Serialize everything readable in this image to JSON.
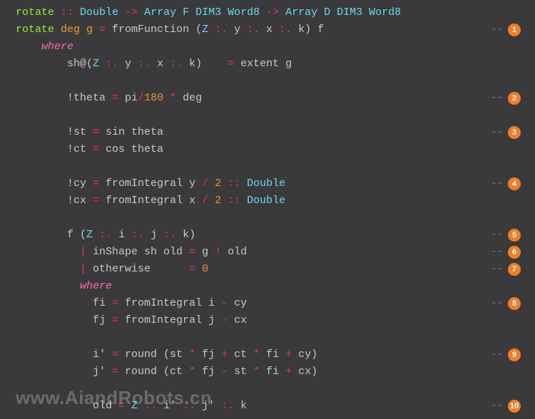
{
  "lines": [
    {
      "tokens": [
        {
          "t": "rotate ",
          "c": "fn"
        },
        {
          "t": ":: ",
          "c": "op"
        },
        {
          "t": "Double ",
          "c": "ty"
        },
        {
          "t": "-> ",
          "c": "op"
        },
        {
          "t": "Array F DIM3 Word8 ",
          "c": "ty"
        },
        {
          "t": "-> ",
          "c": "op"
        },
        {
          "t": "Array D DIM3 Word8",
          "c": "ty"
        }
      ]
    },
    {
      "tokens": [
        {
          "t": "rotate ",
          "c": "fn"
        },
        {
          "t": "deg g ",
          "c": "arg"
        },
        {
          "t": "= ",
          "c": "op"
        },
        {
          "t": "fromFunction (",
          "c": "pun"
        },
        {
          "t": "Z ",
          "c": "ty"
        },
        {
          "t": ":. ",
          "c": "op"
        },
        {
          "t": "y ",
          "c": "pun"
        },
        {
          "t": ":. ",
          "c": "op"
        },
        {
          "t": "x ",
          "c": "pun"
        },
        {
          "t": ":. ",
          "c": "op"
        },
        {
          "t": "k) f",
          "c": "pun"
        }
      ],
      "badge": "1"
    },
    {
      "tokens": [
        {
          "t": "    ",
          "c": "pun"
        },
        {
          "t": "where",
          "c": "kw"
        }
      ]
    },
    {
      "tokens": [
        {
          "t": "        sh@(",
          "c": "pun"
        },
        {
          "t": "Z ",
          "c": "ty"
        },
        {
          "t": ":. ",
          "c": "op"
        },
        {
          "t": "y ",
          "c": "pun"
        },
        {
          "t": ":. ",
          "c": "op"
        },
        {
          "t": "x ",
          "c": "pun"
        },
        {
          "t": ":. ",
          "c": "op"
        },
        {
          "t": "k)    ",
          "c": "pun"
        },
        {
          "t": "= ",
          "c": "op"
        },
        {
          "t": "extent g",
          "c": "pun"
        }
      ]
    },
    {
      "tokens": [
        {
          "t": " ",
          "c": "pun"
        }
      ]
    },
    {
      "tokens": [
        {
          "t": "        !theta ",
          "c": "pun"
        },
        {
          "t": "= ",
          "c": "op"
        },
        {
          "t": "pi",
          "c": "pun"
        },
        {
          "t": "/",
          "c": "op"
        },
        {
          "t": "180 ",
          "c": "num"
        },
        {
          "t": "* ",
          "c": "op"
        },
        {
          "t": "deg",
          "c": "pun"
        }
      ],
      "badge": "2"
    },
    {
      "tokens": [
        {
          "t": " ",
          "c": "pun"
        }
      ]
    },
    {
      "tokens": [
        {
          "t": "        !st ",
          "c": "pun"
        },
        {
          "t": "= ",
          "c": "op"
        },
        {
          "t": "sin theta",
          "c": "pun"
        }
      ],
      "badge": "3"
    },
    {
      "tokens": [
        {
          "t": "        !ct ",
          "c": "pun"
        },
        {
          "t": "= ",
          "c": "op"
        },
        {
          "t": "cos theta",
          "c": "pun"
        }
      ]
    },
    {
      "tokens": [
        {
          "t": " ",
          "c": "pun"
        }
      ]
    },
    {
      "tokens": [
        {
          "t": "        !cy ",
          "c": "pun"
        },
        {
          "t": "= ",
          "c": "op"
        },
        {
          "t": "fromIntegral y ",
          "c": "pun"
        },
        {
          "t": "/ ",
          "c": "op"
        },
        {
          "t": "2 ",
          "c": "num"
        },
        {
          "t": ":: ",
          "c": "op"
        },
        {
          "t": "Double",
          "c": "ty"
        }
      ],
      "badge": "4"
    },
    {
      "tokens": [
        {
          "t": "        !cx ",
          "c": "pun"
        },
        {
          "t": "= ",
          "c": "op"
        },
        {
          "t": "fromIntegral x ",
          "c": "pun"
        },
        {
          "t": "/ ",
          "c": "op"
        },
        {
          "t": "2 ",
          "c": "num"
        },
        {
          "t": ":: ",
          "c": "op"
        },
        {
          "t": "Double",
          "c": "ty"
        }
      ]
    },
    {
      "tokens": [
        {
          "t": " ",
          "c": "pun"
        }
      ]
    },
    {
      "tokens": [
        {
          "t": "        f (",
          "c": "pun"
        },
        {
          "t": "Z ",
          "c": "ty"
        },
        {
          "t": ":. ",
          "c": "op"
        },
        {
          "t": "i ",
          "c": "pun"
        },
        {
          "t": ":. ",
          "c": "op"
        },
        {
          "t": "j ",
          "c": "pun"
        },
        {
          "t": ":. ",
          "c": "op"
        },
        {
          "t": "k)",
          "c": "pun"
        }
      ],
      "badge": "5"
    },
    {
      "tokens": [
        {
          "t": "          | ",
          "c": "op"
        },
        {
          "t": "inShape sh old ",
          "c": "pun"
        },
        {
          "t": "= ",
          "c": "op"
        },
        {
          "t": "g ",
          "c": "pun"
        },
        {
          "t": "! ",
          "c": "op"
        },
        {
          "t": "old",
          "c": "pun"
        }
      ],
      "badge": "6"
    },
    {
      "tokens": [
        {
          "t": "          | ",
          "c": "op"
        },
        {
          "t": "otherwise      ",
          "c": "pun"
        },
        {
          "t": "= ",
          "c": "op"
        },
        {
          "t": "0",
          "c": "num"
        }
      ],
      "badge": "7"
    },
    {
      "tokens": [
        {
          "t": "          ",
          "c": "pun"
        },
        {
          "t": "where",
          "c": "kw"
        }
      ]
    },
    {
      "tokens": [
        {
          "t": "            fi ",
          "c": "pun"
        },
        {
          "t": "= ",
          "c": "op"
        },
        {
          "t": "fromIntegral i ",
          "c": "pun"
        },
        {
          "t": "- ",
          "c": "op"
        },
        {
          "t": "cy",
          "c": "pun"
        }
      ],
      "badge": "8"
    },
    {
      "tokens": [
        {
          "t": "            fj ",
          "c": "pun"
        },
        {
          "t": "= ",
          "c": "op"
        },
        {
          "t": "fromIntegral j ",
          "c": "pun"
        },
        {
          "t": "- ",
          "c": "op"
        },
        {
          "t": "cx",
          "c": "pun"
        }
      ]
    },
    {
      "tokens": [
        {
          "t": " ",
          "c": "pun"
        }
      ]
    },
    {
      "tokens": [
        {
          "t": "            i' ",
          "c": "pun"
        },
        {
          "t": "= ",
          "c": "op"
        },
        {
          "t": "round (st ",
          "c": "pun"
        },
        {
          "t": "* ",
          "c": "op"
        },
        {
          "t": "fj ",
          "c": "pun"
        },
        {
          "t": "+ ",
          "c": "op"
        },
        {
          "t": "ct ",
          "c": "pun"
        },
        {
          "t": "* ",
          "c": "op"
        },
        {
          "t": "fi ",
          "c": "pun"
        },
        {
          "t": "+ ",
          "c": "op"
        },
        {
          "t": "cy)",
          "c": "pun"
        }
      ],
      "badge": "9"
    },
    {
      "tokens": [
        {
          "t": "            j' ",
          "c": "pun"
        },
        {
          "t": "= ",
          "c": "op"
        },
        {
          "t": "round (ct ",
          "c": "pun"
        },
        {
          "t": "* ",
          "c": "op"
        },
        {
          "t": "fj ",
          "c": "pun"
        },
        {
          "t": "- ",
          "c": "op"
        },
        {
          "t": "st ",
          "c": "pun"
        },
        {
          "t": "* ",
          "c": "op"
        },
        {
          "t": "fi ",
          "c": "pun"
        },
        {
          "t": "+ ",
          "c": "op"
        },
        {
          "t": "cx)",
          "c": "pun"
        }
      ]
    },
    {
      "tokens": [
        {
          "t": " ",
          "c": "pun"
        }
      ]
    },
    {
      "tokens": [
        {
          "t": "            old ",
          "c": "pun"
        },
        {
          "t": "= ",
          "c": "op"
        },
        {
          "t": "Z ",
          "c": "ty"
        },
        {
          "t": ":. ",
          "c": "op"
        },
        {
          "t": "i' ",
          "c": "pun"
        },
        {
          "t": ":. ",
          "c": "op"
        },
        {
          "t": "j' ",
          "c": "pun"
        },
        {
          "t": ":. ",
          "c": "op"
        },
        {
          "t": "k",
          "c": "pun"
        }
      ],
      "badge": "10"
    }
  ],
  "annotation_prefix": "--",
  "watermark": "www.AiandRobots.cn"
}
